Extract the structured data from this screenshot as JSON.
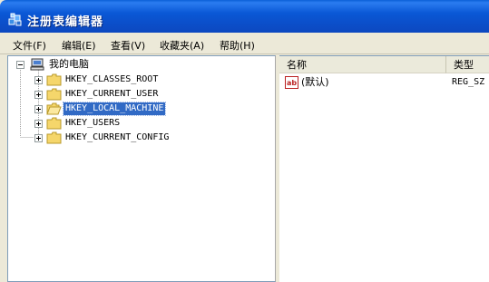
{
  "window": {
    "title": "注册表编辑器"
  },
  "menu": [
    {
      "label": "文件(F)"
    },
    {
      "label": "编辑(E)"
    },
    {
      "label": "查看(V)"
    },
    {
      "label": "收藏夹(A)"
    },
    {
      "label": "帮助(H)"
    }
  ],
  "tree": {
    "root": "我的电脑",
    "keys": [
      {
        "label": "HKEY_CLASSES_ROOT",
        "selected": false
      },
      {
        "label": "HKEY_CURRENT_USER",
        "selected": false
      },
      {
        "label": "HKEY_LOCAL_MACHINE",
        "selected": true
      },
      {
        "label": "HKEY_USERS",
        "selected": false
      },
      {
        "label": "HKEY_CURRENT_CONFIG",
        "selected": false
      }
    ]
  },
  "list": {
    "columns": [
      {
        "label": "名称"
      },
      {
        "label": "类型"
      }
    ],
    "rows": [
      {
        "name": "(默认)",
        "type": "REG_SZ",
        "icon": "string-value-icon"
      }
    ]
  },
  "colors": {
    "title_bar": "#0a58d6",
    "selection": "#316ac5",
    "folder": "#f5d66b"
  }
}
